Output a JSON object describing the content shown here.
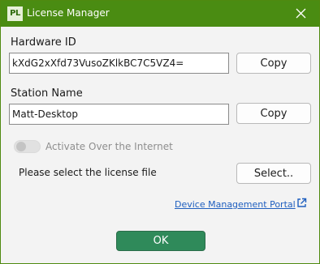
{
  "window": {
    "logo_text": "PL",
    "title": "License Manager"
  },
  "hardware": {
    "label": "Hardware ID",
    "value": "kXdG2xXfd73VusoZKlkBC7C5VZ4=",
    "copy_label": "Copy"
  },
  "station": {
    "label": "Station Name",
    "value": "Matt-Desktop",
    "copy_label": "Copy"
  },
  "activate": {
    "label": "Activate Over the Internet",
    "enabled": false
  },
  "license_file": {
    "prompt": "Please select the license file",
    "select_label": "Select.."
  },
  "portal_link": {
    "label": "Device Management Portal",
    "icon": "external-link-icon"
  },
  "ok_label": "OK",
  "colors": {
    "titlebar": "#4a8c12",
    "ok_button": "#2f8a5a",
    "link": "#1f5fbf"
  }
}
